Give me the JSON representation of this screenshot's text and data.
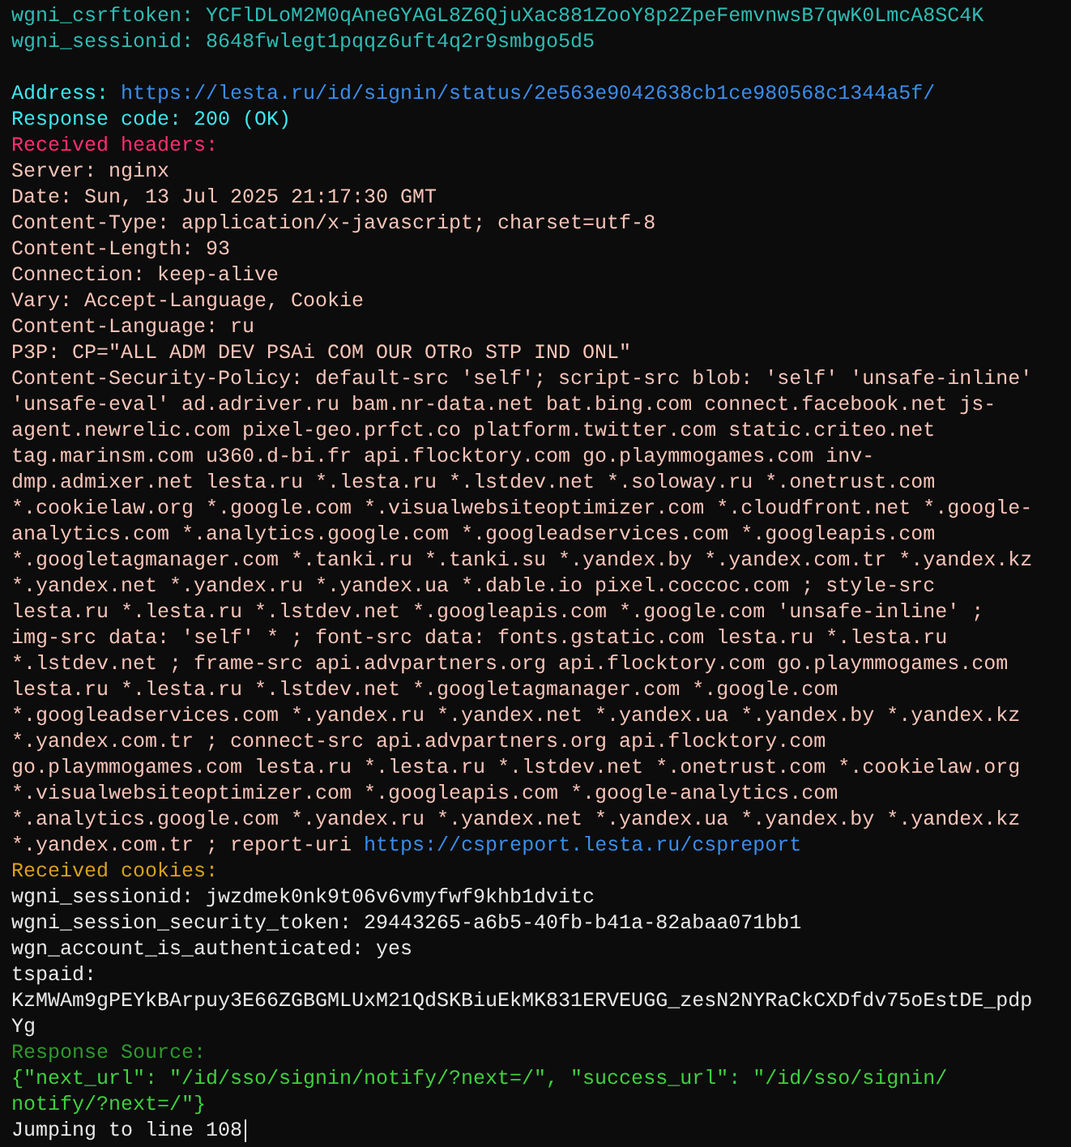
{
  "lines": [
    {
      "kind": "cookie",
      "text": "wgni_csrftoken: YCFlDLoM2M0qAneGYAGL8Z6QjuXac881ZooY8p2ZpeFemvnwsB7qwK0LmcA8SC4K"
    },
    {
      "kind": "cookie",
      "text": "wgni_sessionid: 8648fwlegt1pqqz6uft4q2r9smbgo5d5"
    },
    {
      "kind": "blank"
    },
    {
      "kind": "info",
      "text": "Address:",
      "link": "https://lesta.ru/id/signin/status/2e563e9042638cb1ce980568c1344a5f/"
    },
    {
      "kind": "info",
      "text": "Response code: 200 (OK)"
    },
    {
      "kind": "headers-title",
      "text": "Received headers:"
    },
    {
      "kind": "header",
      "text": "Server: nginx"
    },
    {
      "kind": "header",
      "text": "Date: Sun, 13 Jul 2025 21:17:30 GMT"
    },
    {
      "kind": "header",
      "text": "Content-Type: application/x-javascript; charset=utf-8"
    },
    {
      "kind": "header",
      "text": "Content-Length: 93"
    },
    {
      "kind": "header",
      "text": "Connection: keep-alive"
    },
    {
      "kind": "header",
      "text": "Vary: Accept-Language, Cookie"
    },
    {
      "kind": "header",
      "text": "Content-Language: ru"
    },
    {
      "kind": "header",
      "text": "P3P: CP=\"ALL ADM DEV PSAi COM OUR OTRo STP IND ONL\""
    },
    {
      "kind": "header",
      "text": "Content-Security-Policy: default-src 'self'; script-src blob: 'self' 'unsafe-inline'"
    },
    {
      "kind": "header",
      "text": "'unsafe-eval' ad.adriver.ru bam.nr-data.net bat.bing.com connect.facebook.net js-"
    },
    {
      "kind": "header",
      "text": "agent.newrelic.com pixel-geo.prfct.co platform.twitter.com static.criteo.net"
    },
    {
      "kind": "header",
      "text": "tag.marinsm.com u360.d-bi.fr api.flocktory.com go.playmmogames.com inv-"
    },
    {
      "kind": "header",
      "text": "dmp.admixer.net lesta.ru *.lesta.ru *.lstdev.net *.soloway.ru *.onetrust.com"
    },
    {
      "kind": "header",
      "text": "*.cookielaw.org *.google.com *.visualwebsiteoptimizer.com *.cloudfront.net *.google-"
    },
    {
      "kind": "header",
      "text": "analytics.com *.analytics.google.com *.googleadservices.com *.googleapis.com"
    },
    {
      "kind": "header",
      "text": "*.googletagmanager.com *.tanki.ru *.tanki.su *.yandex.by *.yandex.com.tr *.yandex.kz"
    },
    {
      "kind": "header",
      "text": "*.yandex.net *.yandex.ru *.yandex.ua *.dable.io pixel.coccoc.com ; style-src"
    },
    {
      "kind": "header",
      "text": "lesta.ru *.lesta.ru *.lstdev.net *.googleapis.com *.google.com 'unsafe-inline' ;"
    },
    {
      "kind": "header",
      "text": "img-src data: 'self' * ; font-src data: fonts.gstatic.com lesta.ru *.lesta.ru"
    },
    {
      "kind": "header",
      "text": "*.lstdev.net ; frame-src api.advpartners.org api.flocktory.com go.playmmogames.com"
    },
    {
      "kind": "header",
      "text": "lesta.ru *.lesta.ru *.lstdev.net *.googletagmanager.com *.google.com"
    },
    {
      "kind": "header",
      "text": "*.googleadservices.com *.yandex.ru *.yandex.net *.yandex.ua *.yandex.by *.yandex.kz"
    },
    {
      "kind": "header",
      "text": "*.yandex.com.tr ; connect-src api.advpartners.org api.flocktory.com"
    },
    {
      "kind": "header",
      "text": "go.playmmogames.com lesta.ru *.lesta.ru *.lstdev.net *.onetrust.com *.cookielaw.org"
    },
    {
      "kind": "header",
      "text": "*.visualwebsiteoptimizer.com *.googleapis.com *.google-analytics.com"
    },
    {
      "kind": "header",
      "text": "*.analytics.google.com *.yandex.ru *.yandex.net *.yandex.ua *.yandex.by *.yandex.kz"
    },
    {
      "kind": "header",
      "text": "*.yandex.com.tr ; report-uri",
      "link": "https://cspreport.lesta.ru/cspreport"
    },
    {
      "kind": "cookies-title",
      "text": "Received cookies:"
    },
    {
      "kind": "value",
      "text": "wgni_sessionid: jwzdmek0nk9t06v6vmyfwf9khb1dvitc"
    },
    {
      "kind": "value",
      "text": "wgni_session_security_token: 29443265-a6b5-40fb-b41a-82abaa071bb1"
    },
    {
      "kind": "value",
      "text": "wgn_account_is_authenticated: yes"
    },
    {
      "kind": "value",
      "text": "tspaid:"
    },
    {
      "kind": "value",
      "text": "KzMWAm9gPEYkBArpuy3E66ZGBGMLUxM21QdSKBiuEkMK831ERVEUGG_zesN2NYRaCkCXDfdv75oEstDE_pdp"
    },
    {
      "kind": "value",
      "text": "Yg"
    },
    {
      "kind": "source-title",
      "text": "Response Source:"
    },
    {
      "kind": "source",
      "text": "{\"next_url\": \"/id/sso/signin/notify/?next=/\", \"success_url\": \"/id/sso/signin/"
    },
    {
      "kind": "source",
      "text": "notify/?next=/\"}"
    },
    {
      "kind": "prompt",
      "text": "Jumping to line 108",
      "cursor": true
    }
  ]
}
